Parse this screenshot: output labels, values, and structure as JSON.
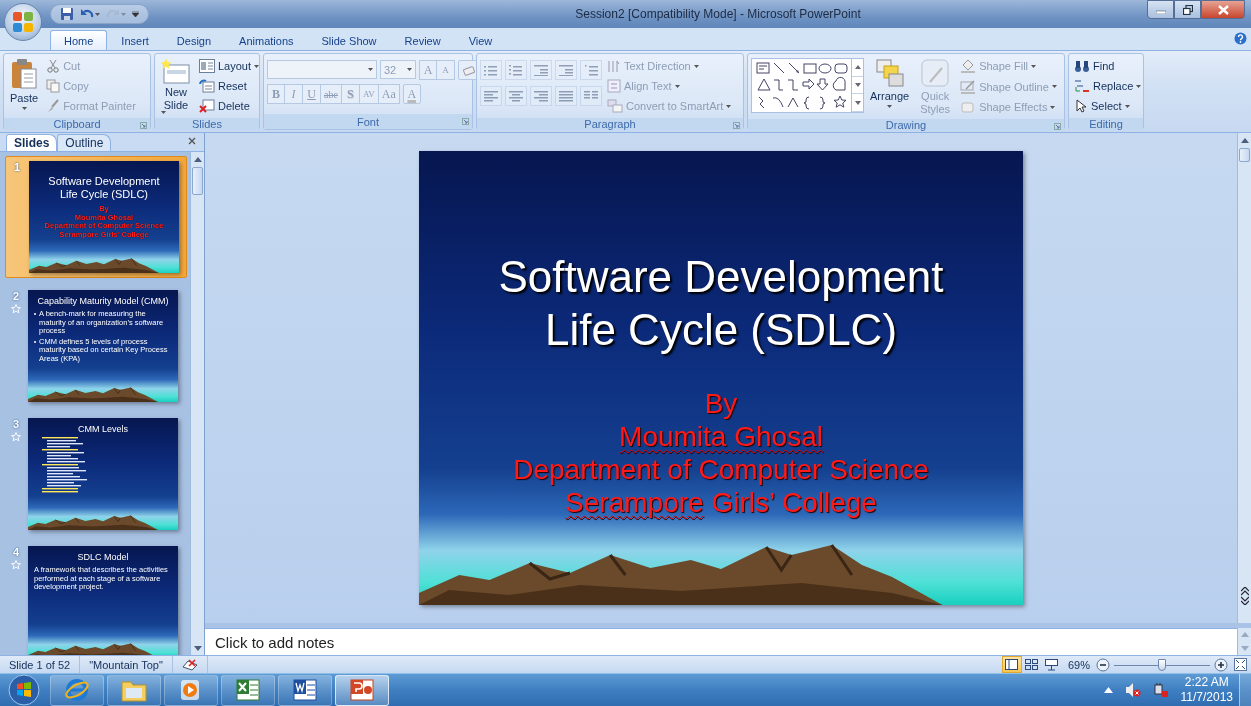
{
  "window": {
    "title": "Session2 [Compatibility Mode] - Microsoft PowerPoint"
  },
  "quick_access": [
    {
      "disabled": false
    },
    {
      "disabled": false
    },
    {
      "disabled": true
    }
  ],
  "ribbon_tabs": [
    {
      "label": "Home",
      "selected": true
    },
    {
      "label": "Insert",
      "selected": false
    },
    {
      "label": "Design",
      "selected": false
    },
    {
      "label": "Animations",
      "selected": false
    },
    {
      "label": "Slide Show",
      "selected": false
    },
    {
      "label": "Review",
      "selected": false
    },
    {
      "label": "View",
      "selected": false
    }
  ],
  "ribbon": {
    "clipboard": {
      "label": "Clipboard",
      "paste": {
        "label": "Paste",
        "disabled": false
      },
      "commands": [
        {
          "label": "Cut",
          "disabled": true
        },
        {
          "label": "Copy",
          "disabled": true
        },
        {
          "label": "Format Painter",
          "disabled": true
        }
      ]
    },
    "slides": {
      "label": "Slides",
      "new_slide": {
        "label": "New Slide",
        "dropdown": true
      },
      "commands": [
        {
          "label": "Layout",
          "dropdown": true
        },
        {
          "label": "Reset",
          "dropdown": false
        },
        {
          "label": "Delete",
          "dropdown": false
        }
      ]
    },
    "font": {
      "label": "Font",
      "disabled": true,
      "size": "32",
      "grow": "A",
      "shrink": "A",
      "formats": [
        "B",
        "I",
        "U",
        "abe",
        "S",
        "AV",
        "Aa",
        "A"
      ]
    },
    "paragraph": {
      "label": "Paragraph",
      "disabled": true,
      "commands": [
        {
          "label": "Text Direction",
          "dropdown": true
        },
        {
          "label": "Align Text",
          "dropdown": true
        },
        {
          "label": "Convert to SmartArt",
          "dropdown": true
        }
      ]
    },
    "drawing": {
      "label": "Drawing",
      "arrange": {
        "label": "Arrange",
        "disabled": false
      },
      "quick_styles": {
        "label": "Quick Styles",
        "disabled": true
      },
      "commands": [
        {
          "label": "Shape Fill",
          "disabled": true
        },
        {
          "label": "Shape Outline",
          "disabled": true
        },
        {
          "label": "Shape Effects",
          "disabled": true
        }
      ]
    },
    "editing": {
      "label": "Editing",
      "commands": [
        {
          "label": "Find",
          "dropdown": false
        },
        {
          "label": "Replace",
          "dropdown": true
        },
        {
          "label": "Select",
          "dropdown": true
        }
      ]
    }
  },
  "pane_tabs": [
    {
      "label": "Slides",
      "selected": true
    },
    {
      "label": "Outline",
      "selected": false
    }
  ],
  "thumbnails": [
    {
      "number": "1",
      "selected": true,
      "animated": false,
      "kind": "title",
      "title": "Software Development Life Cycle (SDLC)",
      "lines": [
        "By",
        "Moumita Ghosal",
        "Department of Computer Science",
        "Serampore Girls’ College"
      ]
    },
    {
      "number": "2",
      "selected": false,
      "animated": true,
      "kind": "bullets",
      "title": "Capability Maturity Model (CMM)",
      "lines": [
        "A bench-mark for measuring the maturity of an organization’s software process",
        "CMM defines 5 levels of process maturity based on certain Key Process Areas (KPA)"
      ]
    },
    {
      "number": "3",
      "selected": false,
      "animated": true,
      "kind": "dense",
      "title": "CMM Levels"
    },
    {
      "number": "4",
      "selected": false,
      "animated": true,
      "kind": "text",
      "title": "SDLC Model",
      "lines": [
        "A framework that describes the activities performed at each stage of a software development project."
      ]
    }
  ],
  "slide": {
    "title": "Software Development Life Cycle (SDLC)",
    "subtitle": [
      [
        {
          "text": "By",
          "spell_error": false
        }
      ],
      [
        {
          "text": "Moumita Ghosal",
          "spell_error": true
        }
      ],
      [
        {
          "text": "Department of Computer Science",
          "spell_error": false
        }
      ],
      [
        {
          "text": "Serampore",
          "spell_error": true
        },
        {
          "text": " Girls’ College",
          "spell_error": false
        }
      ]
    ]
  },
  "notes": {
    "placeholder": "Click to add notes"
  },
  "status_bar": {
    "slide_info": "Slide 1 of 52",
    "theme": "\"Mountain Top\"",
    "view_buttons": [
      {
        "selected": true
      },
      {
        "selected": false
      },
      {
        "selected": false
      }
    ],
    "zoom": "69%",
    "zoom_slider": {
      "level": 0.5
    }
  },
  "taskbar": {
    "apps": [
      {
        "active": false
      },
      {
        "active": false
      },
      {
        "active": false
      },
      {
        "active": false
      },
      {
        "active": false
      },
      {
        "active": true
      }
    ],
    "time": "2:22 AM",
    "date": "11/7/2013"
  }
}
